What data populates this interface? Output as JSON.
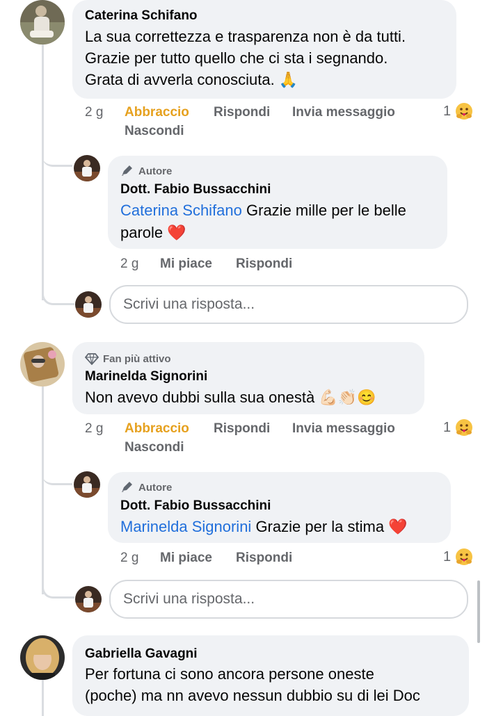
{
  "comments": [
    {
      "author": "Caterina Schifano",
      "lines": [
        "La sua correttezza e trasparenza non è da tutti.",
        "Grazie per tutto quello che ci sta i segnando.",
        "Grata di avverla conosciuta. 🙏"
      ],
      "time": "2 g",
      "actions": [
        "Abbraccio",
        "Rispondi",
        "Invia messaggio",
        "Nascondi"
      ],
      "reaction_count": "1",
      "reply": {
        "badge": "Autore",
        "author": "Dott. Fabio Bussacchini",
        "mention": "Caterina Schifano",
        "text_line1": " Grazie mille per le belle",
        "text_line2": "parole ❤️",
        "time": "2 g",
        "actions": [
          "Mi piace",
          "Rispondi"
        ]
      },
      "reply_placeholder": "Scrivi una risposta..."
    },
    {
      "badge": "Fan più attivo",
      "author": "Marinelda Signorini",
      "text": "Non avevo dubbi sulla sua onestà 💪🏻👏🏻😊",
      "time": "2 g",
      "actions": [
        "Abbraccio",
        "Rispondi",
        "Invia messaggio",
        "Nascondi"
      ],
      "reaction_count": "1",
      "reply": {
        "badge": "Autore",
        "author": "Dott. Fabio Bussacchini",
        "mention": "Marinelda Signorini",
        "text": " Grazie per la stima ❤️",
        "time": "2 g",
        "actions": [
          "Mi piace",
          "Rispondi"
        ],
        "reaction_count": "1"
      },
      "reply_placeholder": "Scrivi una risposta..."
    },
    {
      "author": "Gabriella Gavagni",
      "lines": [
        "Per fortuna ci sono ancora persone oneste",
        "(poche) ma nn avevo nessun dubbio su di lei Doc"
      ]
    }
  ],
  "colors": {
    "hug": "#e6a11f",
    "mention": "#216fdb",
    "bubble": "#f0f2f5",
    "muted": "#65676b"
  },
  "icons": {
    "author_badge": "pencil-icon",
    "fan_badge": "diamond-icon",
    "reaction": "hug-emoji-icon"
  }
}
